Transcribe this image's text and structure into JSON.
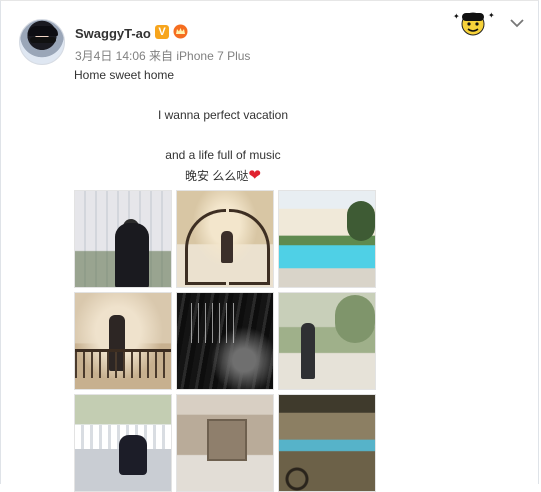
{
  "user": {
    "name": "SwaggyT-ao",
    "verified_label": "V"
  },
  "post": {
    "meta": "3月4日 14:06 来自 iPhone 7 Plus",
    "lines": [
      "Home sweet home",
      "I wanna perfect vacation",
      "and a life full of music",
      "晚安 么么哒"
    ],
    "heart": "❤"
  },
  "icons": {
    "verified": "verified-v-icon",
    "member": "member-crown-icon",
    "sticker": "avatar-sticker-icon",
    "menu": "chevron-down-icon"
  },
  "colors": {
    "verified_bg": "#f7a51c",
    "heart": "#e0212f",
    "meta_text": "#808080"
  },
  "photos": [
    {
      "id": "photo-1"
    },
    {
      "id": "photo-2"
    },
    {
      "id": "photo-3"
    },
    {
      "id": "photo-4"
    },
    {
      "id": "photo-5"
    },
    {
      "id": "photo-6"
    },
    {
      "id": "photo-7"
    },
    {
      "id": "photo-8"
    },
    {
      "id": "photo-9"
    }
  ]
}
